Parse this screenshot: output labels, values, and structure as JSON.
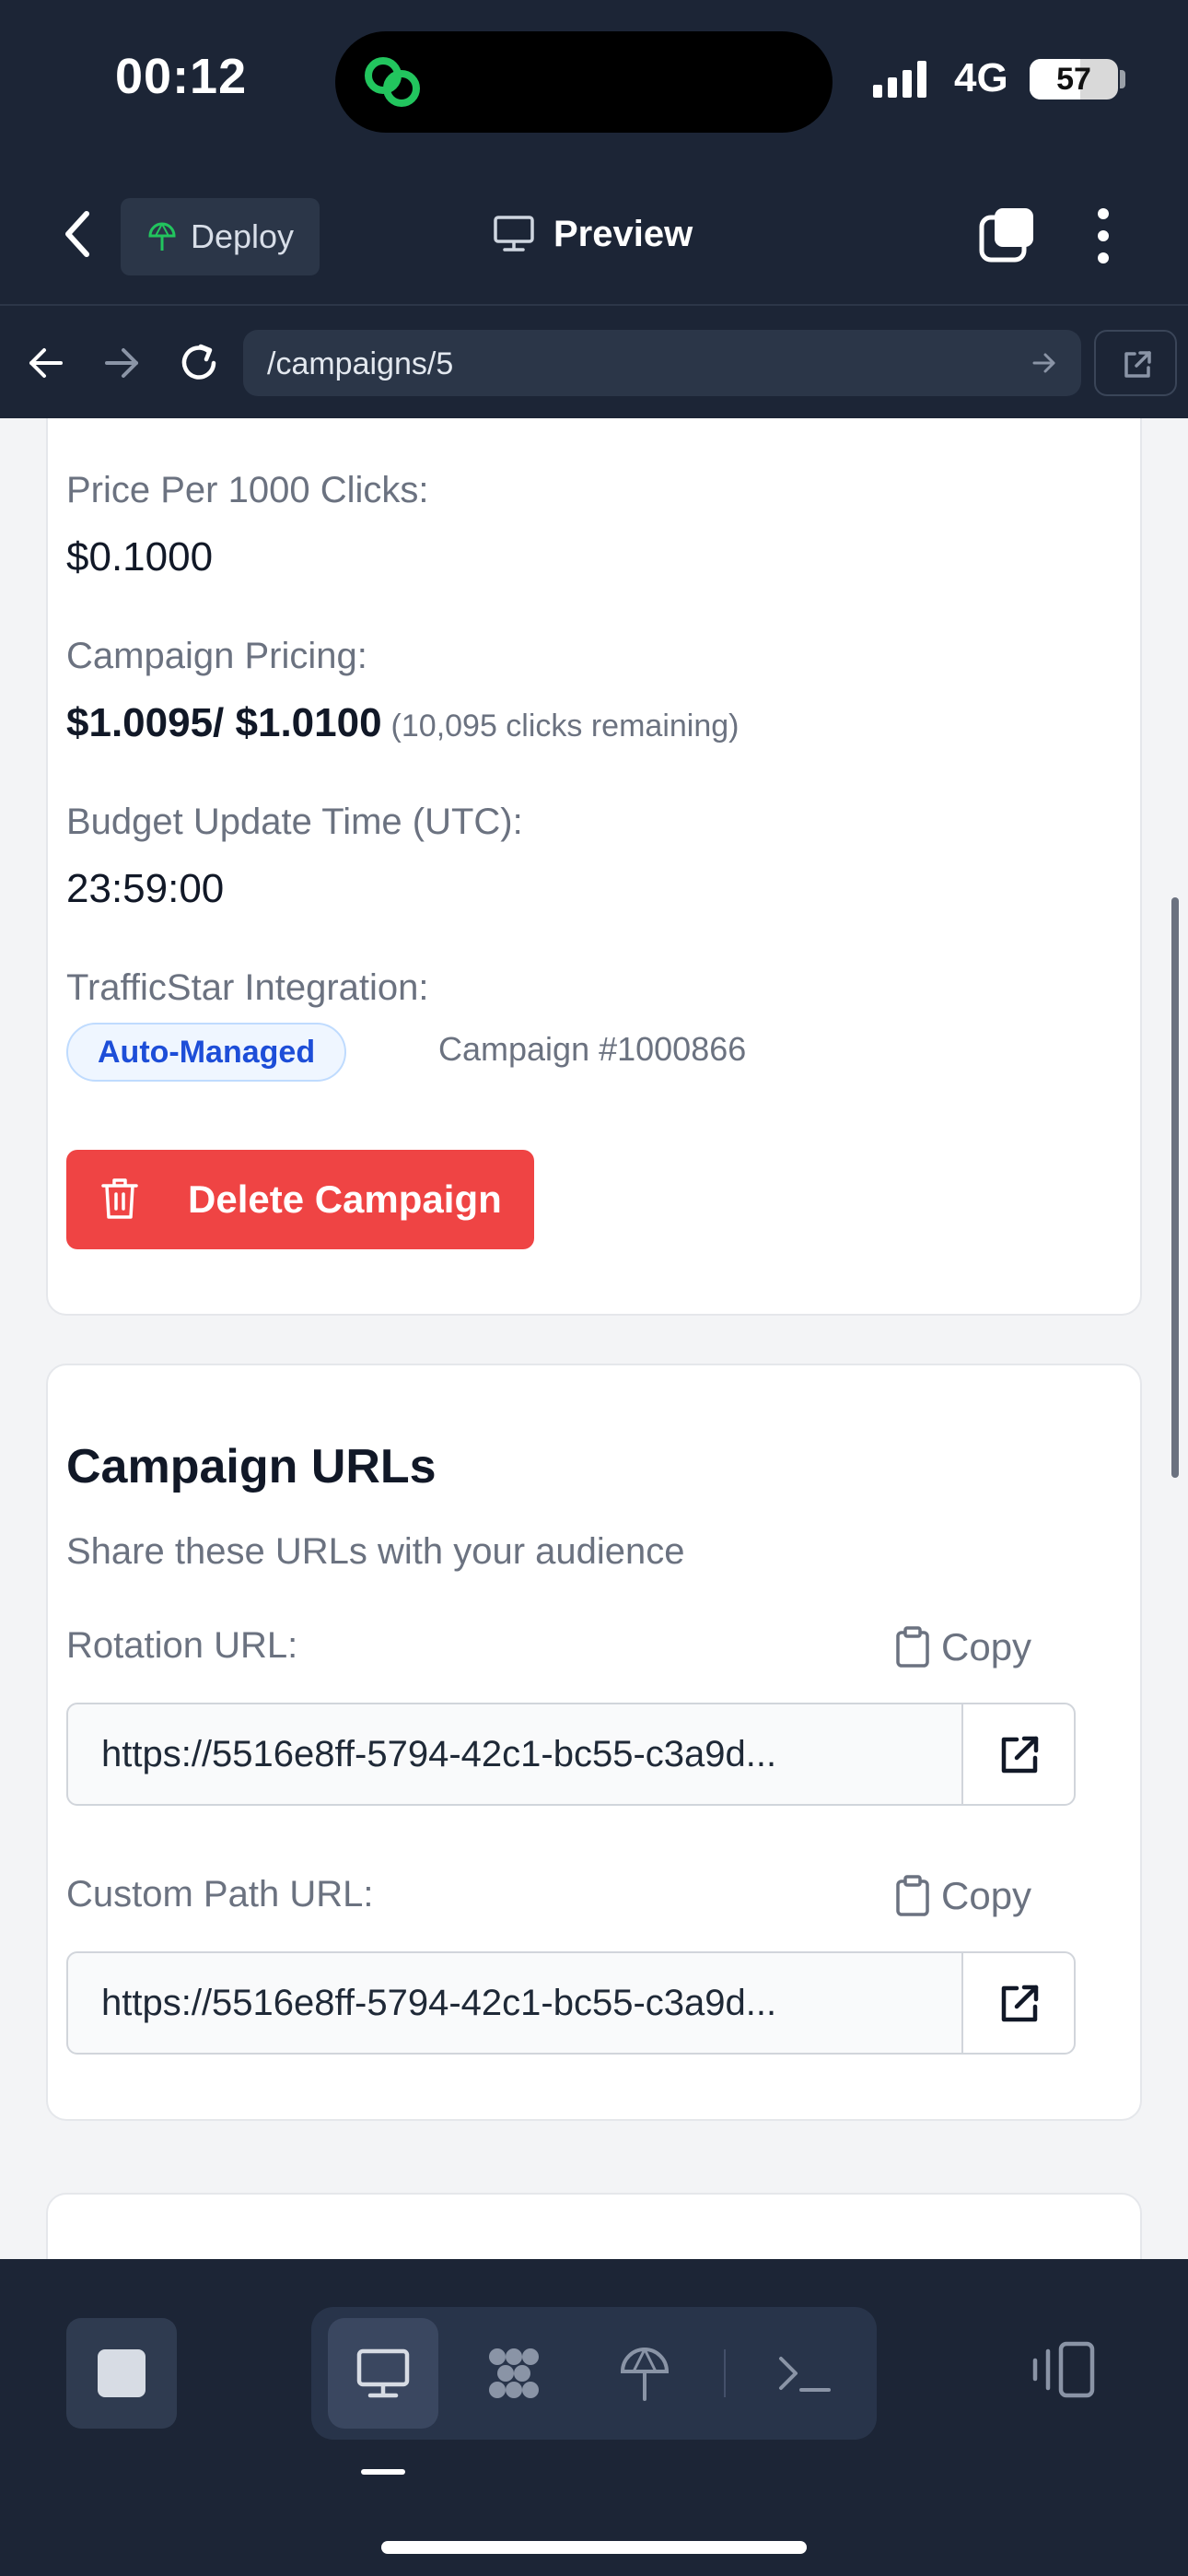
{
  "status": {
    "time": "00:12",
    "network": "4G",
    "battery": "57",
    "battery_level": 0.57
  },
  "app_bar": {
    "deploy_label": "Deploy",
    "preview_label": "Preview"
  },
  "browser": {
    "url": "/campaigns/5"
  },
  "campaign": {
    "price_label": "Price Per 1000 Clicks:",
    "price_value": "$0.1000",
    "pricing_label": "Campaign Pricing:",
    "pricing_value": "$1.0095/ $1.0100",
    "pricing_note": "(10,095 clicks remaining)",
    "budget_label": "Budget Update Time (UTC):",
    "budget_value": "23:59:00",
    "integration_label": "TrafficStar Integration:",
    "integration_badge": "Auto-Managed",
    "integration_note": "Campaign #1000866",
    "delete_label": "Delete Campaign"
  },
  "urls_card": {
    "title": "Campaign URLs",
    "subtitle": "Share these URLs with your audience",
    "rotation_label": "Rotation URL:",
    "rotation_copy": "Copy",
    "rotation_value": "https://5516e8ff-5794-42c1-bc55-c3a9d...",
    "custom_label": "Custom Path URL:",
    "custom_copy": "Copy",
    "custom_value": "https://5516e8ff-5794-42c1-bc55-c3a9d..."
  },
  "colors": {
    "chrome": "#1c2536",
    "danger": "#ef4444",
    "badge_blue": "#1d4ed8"
  },
  "icons": [
    "chevron-left-icon",
    "deploy-icon",
    "monitor-icon",
    "tabs-icon",
    "more-vertical-icon",
    "arrow-left-icon",
    "arrow-right-icon",
    "reload-icon",
    "external-link-icon",
    "trash-icon",
    "clipboard-icon",
    "stop-icon",
    "desktop-icon",
    "apps-icon",
    "antenna-icon",
    "terminal-icon",
    "device-icon"
  ]
}
